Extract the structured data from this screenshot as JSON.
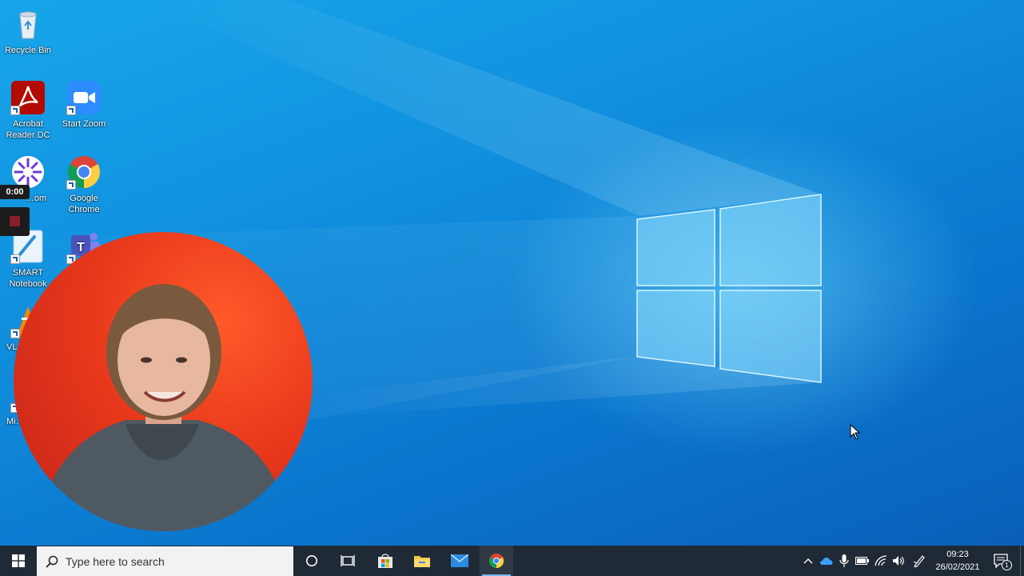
{
  "desktop": {
    "icons": [
      {
        "label": "Recycle Bin",
        "icon": "recycle-bin-icon"
      },
      {
        "label": "Acrobat Reader DC",
        "icon": "acrobat-reader-icon"
      },
      {
        "label": "Start Zoom",
        "icon": "zoom-icon"
      },
      {
        "label": "…om",
        "icon": "screencast-app-icon"
      },
      {
        "label": "Google Chrome",
        "icon": "chrome-icon"
      },
      {
        "label": "SMART Notebook",
        "icon": "smart-notebook-icon"
      },
      {
        "label": "",
        "icon": "teams-icon"
      },
      {
        "label": "VL…",
        "icon": "vlc-icon"
      },
      {
        "label": "Mi… E…",
        "icon": "edge-icon"
      }
    ]
  },
  "recorder": {
    "timer": "0:00",
    "stop_icon": "stop-recording-icon"
  },
  "taskbar": {
    "search_placeholder": "Type here to search",
    "pinned": [
      "start-icon",
      "cortana-icon",
      "task-view-icon",
      "store-icon",
      "file-explorer-icon",
      "mail-icon",
      "chrome-icon"
    ],
    "active_app": "Google Chrome",
    "tray": [
      "chevron-up-icon",
      "onedrive-icon",
      "microphone-icon",
      "battery-icon",
      "wifi-icon",
      "volume-icon",
      "pen-icon"
    ],
    "time": "09:23",
    "date": "26/02/2021",
    "notification_count": "1"
  },
  "colors": {
    "desktop_blue": "#1190de",
    "taskbar": "#1f2a36",
    "webcam_bg": "#e8381b"
  }
}
